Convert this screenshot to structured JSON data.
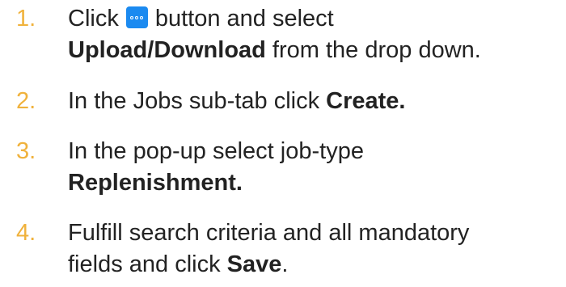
{
  "steps": [
    {
      "number": "1.",
      "line1_before": "Click",
      "button_icon": "more-options-icon",
      "line1_after": "button and select",
      "line2_bold": "Upload/Download",
      "line2_after": " from the drop down."
    },
    {
      "number": "2.",
      "before": "In the Jobs sub-tab click ",
      "bold": "Create."
    },
    {
      "number": "3.",
      "line1": "In the pop-up select job-type",
      "line2_bold": "Replenishment."
    },
    {
      "number": "4.",
      "line1": "Fulfill search criteria and all mandatory",
      "line2_before": "fields and click ",
      "line2_bold": "Save",
      "line2_after": "."
    }
  ],
  "colors": {
    "number": "#f0b23c",
    "text": "#222222",
    "button": "#1b8af0"
  }
}
